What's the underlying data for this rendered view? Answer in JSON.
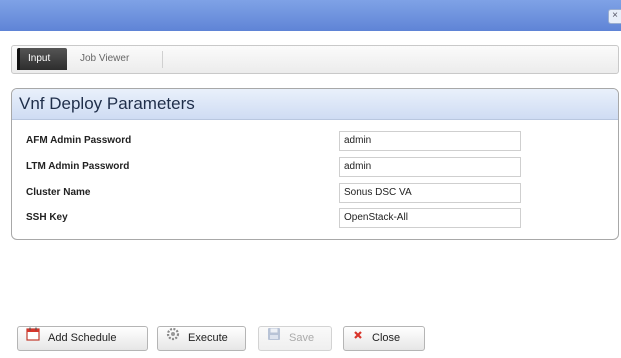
{
  "window": {
    "close_glyph": "×"
  },
  "tabs": [
    {
      "label": "Input",
      "active": true
    },
    {
      "label": "Job Viewer",
      "active": false
    }
  ],
  "panel": {
    "title": "Vnf Deploy Parameters",
    "fields": [
      {
        "label": "AFM Admin Password",
        "value": "admin"
      },
      {
        "label": "LTM Admin Password",
        "value": "admin"
      },
      {
        "label": "Cluster Name",
        "value": "Sonus DSC VA"
      },
      {
        "label": "SSH Key",
        "value": "OpenStack-All"
      }
    ]
  },
  "buttons": {
    "add_schedule": "Add Schedule",
    "execute": "Execute",
    "save": "Save",
    "close": "Close"
  },
  "icons": {
    "calendar": "calendar-icon",
    "gear": "gear-icon",
    "disk": "save-disk-icon",
    "x": "close-x-icon"
  },
  "colors": {
    "titlebar": "#6a8fdd",
    "panel_header": "#dbe5f7",
    "active_tab": "#3a3a3a",
    "close_red": "#d9352b"
  }
}
